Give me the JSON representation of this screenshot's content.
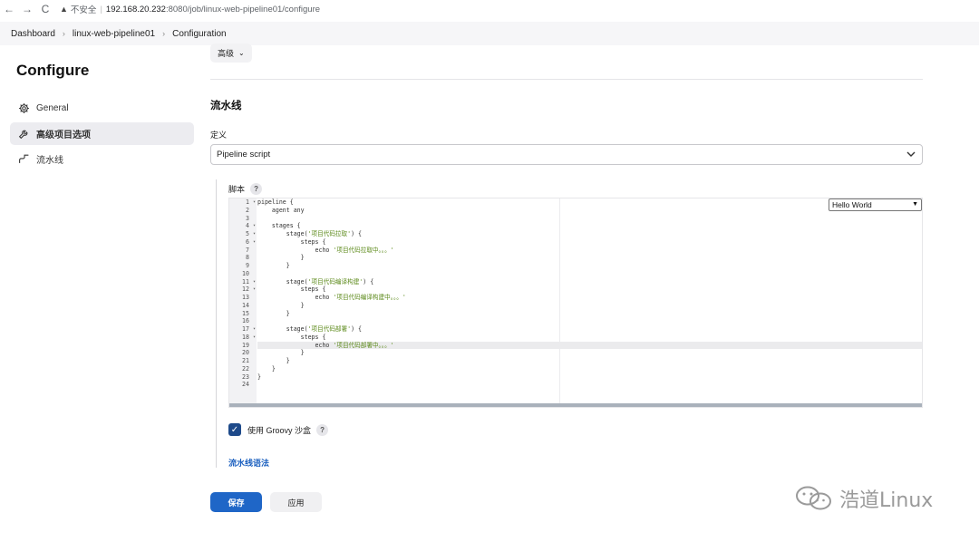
{
  "browser": {
    "back": "←",
    "forward": "→",
    "reload": "C",
    "insecure": "不安全",
    "url_host": "192.168.20.232",
    "url_path": ":8080/job/linux-web-pipeline01/configure"
  },
  "breadcrumb": [
    "Dashboard",
    "linux-web-pipeline01",
    "Configuration"
  ],
  "sidebar": {
    "title": "Configure",
    "items": [
      {
        "label": "General",
        "icon": "gear-icon"
      },
      {
        "label": "高级项目选项",
        "icon": "wrench-icon",
        "active": true
      },
      {
        "label": "流水线",
        "icon": "pipeline-icon"
      }
    ]
  },
  "main": {
    "advanced_button": "高级",
    "section_title": "流水线",
    "definition_label": "定义",
    "definition_value": "Pipeline script",
    "script_label": "脚本",
    "help": "?",
    "sample_value": "Hello World",
    "groovy_label": "使用 Groovy 沙盒",
    "syntax_link": "流水线语法",
    "save": "保存",
    "apply": "应用"
  },
  "editor": {
    "highlight_line": 19,
    "fold_lines": [
      1,
      4,
      5,
      6,
      11,
      12,
      17,
      18
    ],
    "lines": [
      "pipeline {",
      "    agent any",
      "",
      "    stages {",
      "        stage('项目代码拉取') {",
      "            steps {",
      "                echo '项目代码拉取中。。。'",
      "            }",
      "        }",
      "",
      "        stage('项目代码编译构建') {",
      "            steps {",
      "                echo '项目代码编译构建中。。。'",
      "            }",
      "        }",
      "",
      "        stage('项目代码部署') {",
      "            steps {",
      "                echo '项目代码部署中。。。'",
      "            }",
      "        }",
      "    }",
      "}",
      ""
    ]
  },
  "watermark": "浩道Linux",
  "colors": {
    "primary": "#1f66c7",
    "checkbox": "#1e4a8a",
    "string": "#5c8a1a",
    "link": "#1a5fbf"
  }
}
